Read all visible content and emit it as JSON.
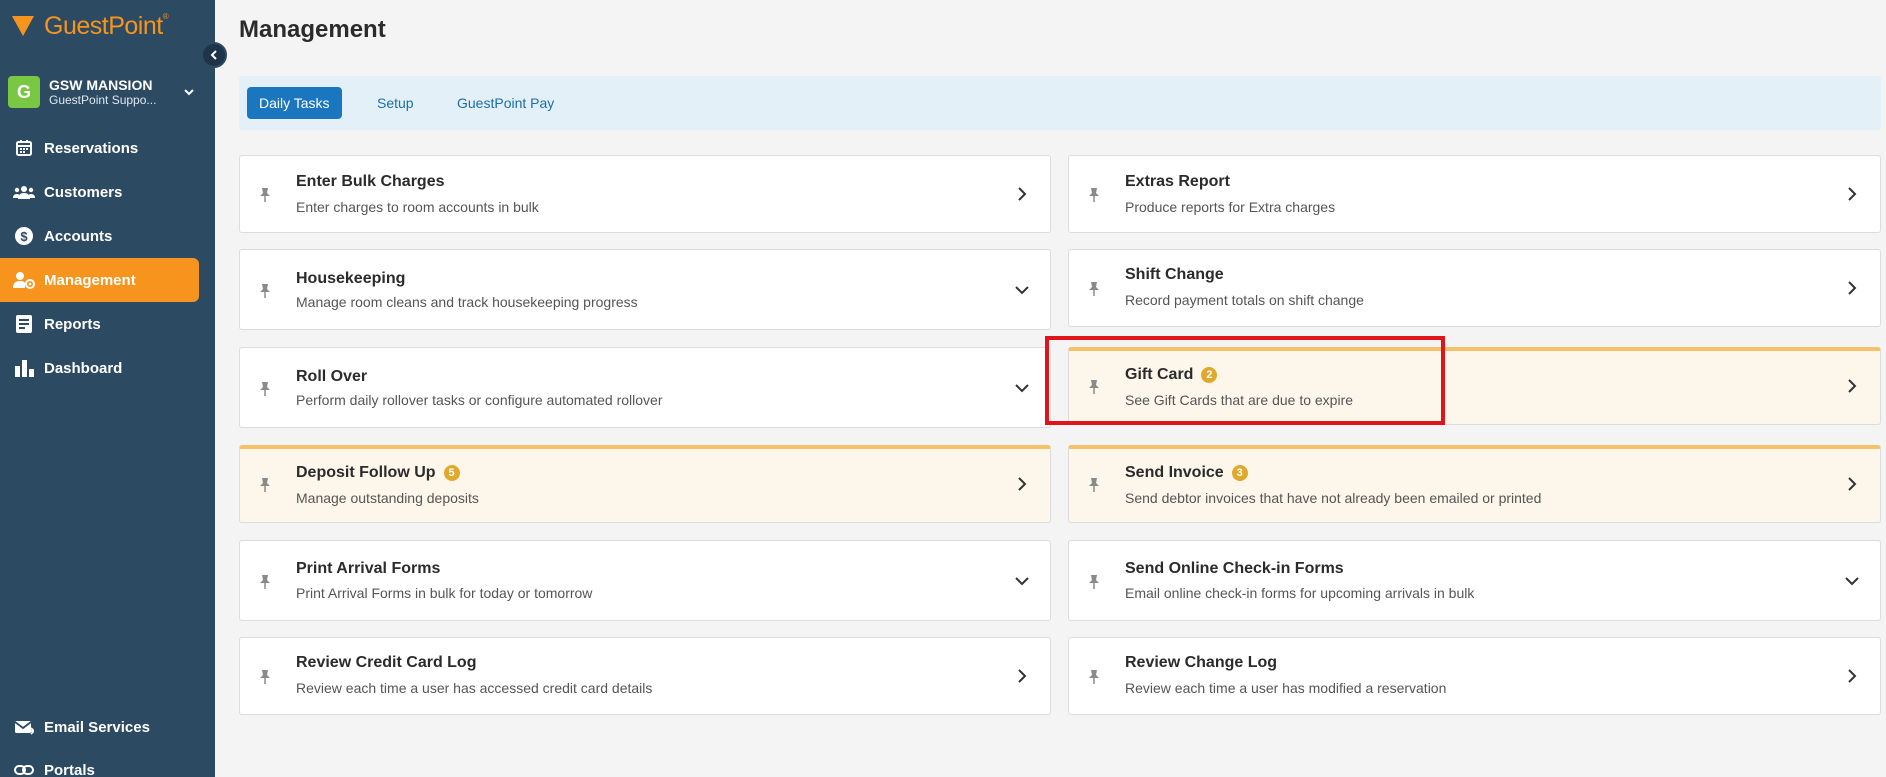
{
  "brand": {
    "name": "GuestPoint",
    "mark": "®"
  },
  "property": {
    "initial": "G",
    "name": "GSW MANSION",
    "subtitle": "GuestPoint Suppo..."
  },
  "nav": [
    {
      "label": "Reservations",
      "icon": "calendar-icon"
    },
    {
      "label": "Customers",
      "icon": "users-icon"
    },
    {
      "label": "Accounts",
      "icon": "dollar-icon"
    },
    {
      "label": "Management",
      "icon": "user-gear-icon",
      "active": true
    },
    {
      "label": "Reports",
      "icon": "report-icon"
    },
    {
      "label": "Dashboard",
      "icon": "bar-chart-icon"
    }
  ],
  "nav_bottom": [
    {
      "label": "Email Services",
      "icon": "mail-icon"
    },
    {
      "label": "Portals",
      "icon": "link-icon"
    }
  ],
  "page": {
    "title": "Management"
  },
  "tabs": [
    {
      "label": "Daily Tasks",
      "active": true
    },
    {
      "label": "Setup"
    },
    {
      "label": "GuestPoint Pay"
    }
  ],
  "cards": [
    {
      "title": "Enter Bulk Charges",
      "desc": "Enter charges to room accounts in bulk",
      "action": "chevron-right"
    },
    {
      "title": "Extras Report",
      "desc": "Produce reports for Extra charges",
      "action": "chevron-right"
    },
    {
      "title": "Housekeeping",
      "desc": "Manage room cleans and track housekeeping progress",
      "action": "chevron-down"
    },
    {
      "title": "Shift Change",
      "desc": "Record payment totals on shift change",
      "action": "chevron-right"
    },
    {
      "title": "Roll Over",
      "desc": "Perform daily rollover tasks or configure automated rollover",
      "action": "chevron-down"
    },
    {
      "title": "Gift Card",
      "badge": "2",
      "desc": "See Gift Cards that are due to expire",
      "action": "chevron-right",
      "alert": true
    },
    {
      "title": "Deposit Follow Up",
      "badge": "5",
      "desc": "Manage outstanding deposits",
      "action": "chevron-right",
      "alert": true
    },
    {
      "title": "Send Invoice",
      "badge": "3",
      "desc": "Send debtor invoices that have not already been emailed or printed",
      "action": "chevron-right",
      "alert": true
    },
    {
      "title": "Print Arrival Forms",
      "desc": "Print Arrival Forms in bulk for today or tomorrow",
      "action": "chevron-down"
    },
    {
      "title": "Send Online Check-in Forms",
      "desc": "Email online check-in forms for upcoming arrivals in bulk",
      "action": "chevron-down"
    },
    {
      "title": "Review Credit Card Log",
      "desc": "Review each time a user has accessed credit card details",
      "action": "chevron-right"
    },
    {
      "title": "Review Change Log",
      "desc": "Review each time a user has modified a reservation",
      "action": "chevron-right"
    }
  ],
  "colors": {
    "sidebar": "#2d4a63",
    "accent": "#f7941d",
    "tab_active": "#1a76bf",
    "alert_border": "#f5c26a",
    "highlight": "#e0141b"
  }
}
